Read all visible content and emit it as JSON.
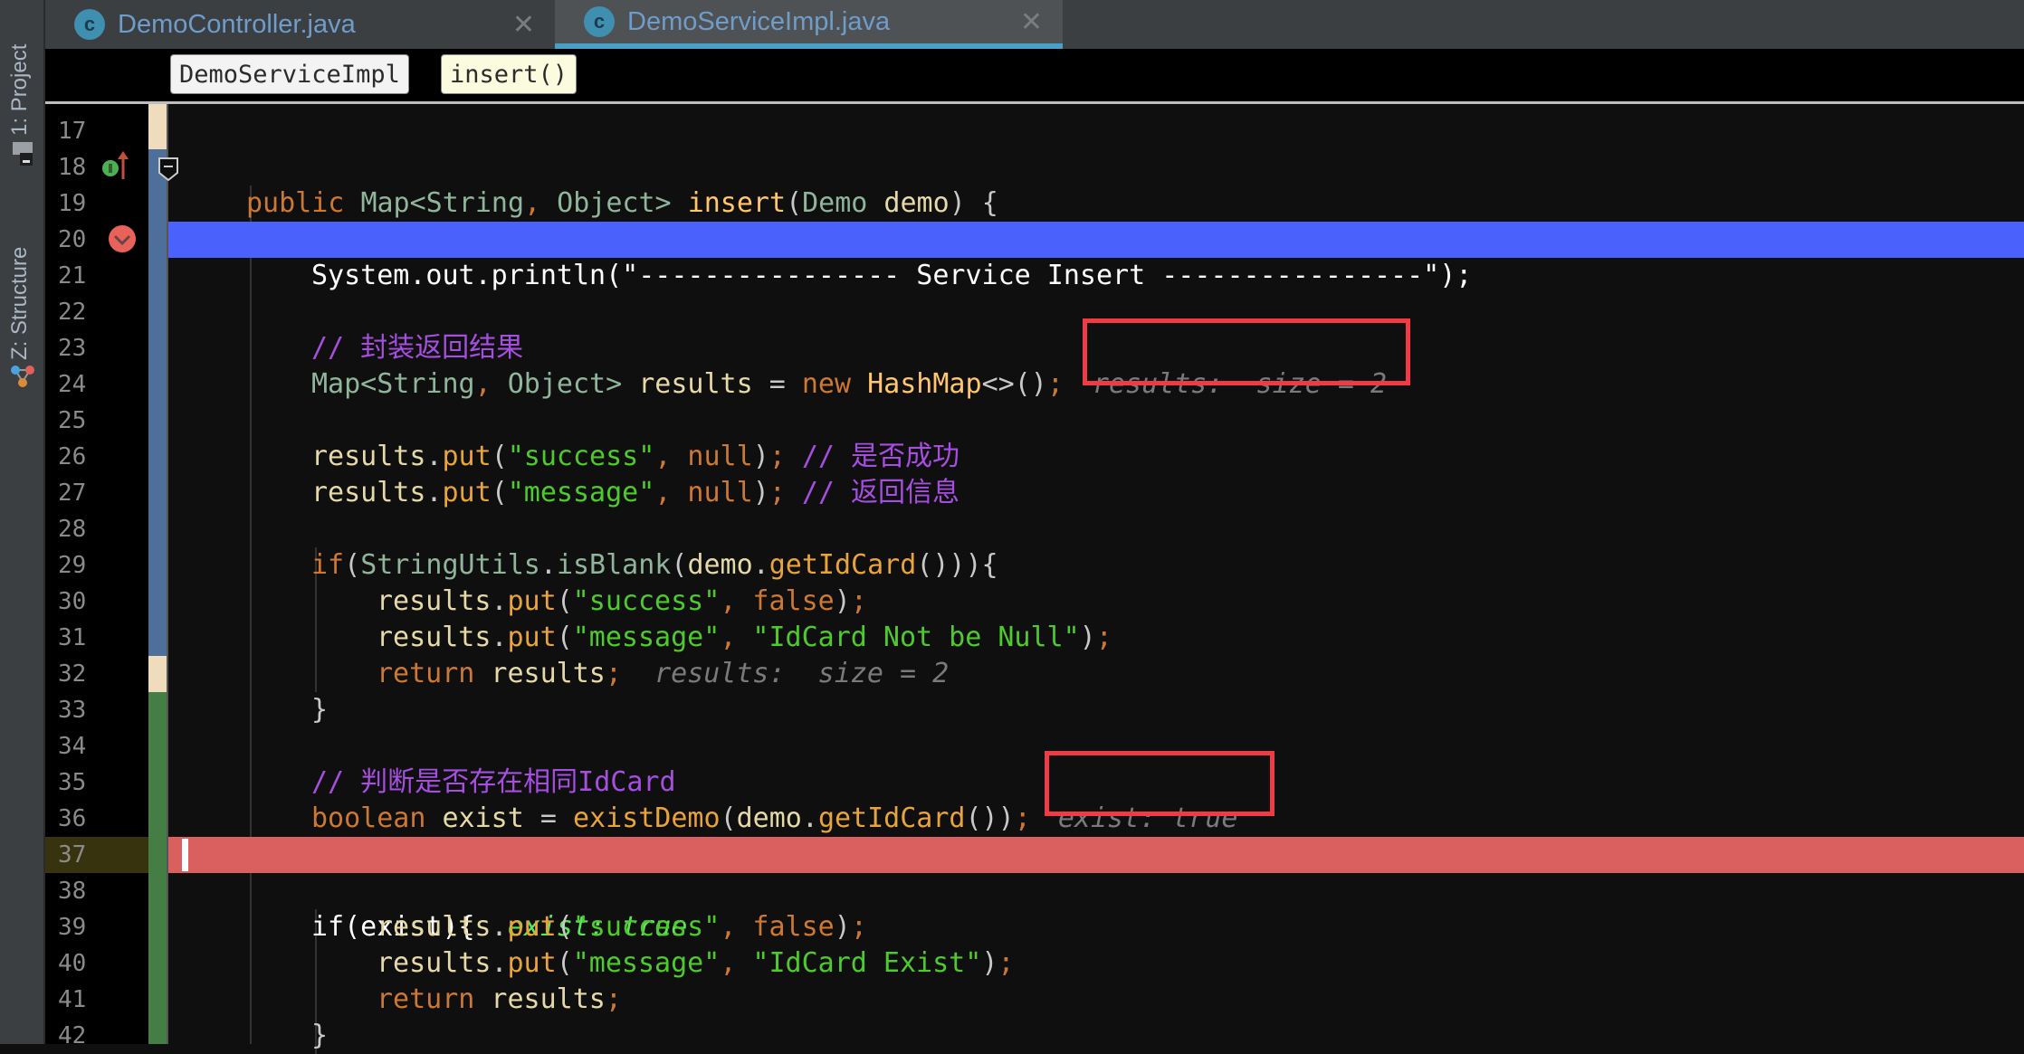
{
  "toolwindows": {
    "project": "1: Project",
    "structure": "Z: Structure"
  },
  "tabs": [
    {
      "label": "DemoController.java",
      "icon": "class-icon",
      "icon_glyph": "c",
      "active": false
    },
    {
      "label": "DemoServiceImpl.java",
      "icon": "class-icon",
      "icon_glyph": "c",
      "active": true
    }
  ],
  "close_glyph": "✕",
  "breadcrumbs": [
    "DemoServiceImpl",
    "insert()"
  ],
  "colors": {
    "execution_line": "#4a62fb",
    "breakpoint_line": "#d9605f",
    "tab_underline": "#4a9fc4",
    "annotation_box": "#f13b44"
  },
  "editor": {
    "lines": [
      {
        "n": "17"
      },
      {
        "n": "18",
        "gutter_icons": [
          "implements-icon",
          "overrides-arrow-icon"
        ]
      },
      {
        "n": "19"
      },
      {
        "n": "20",
        "gutter_icons": [
          "breakpoint-verified-icon"
        ],
        "highlight": "execution"
      },
      {
        "n": "21"
      },
      {
        "n": "22"
      },
      {
        "n": "23"
      },
      {
        "n": "24"
      },
      {
        "n": "25"
      },
      {
        "n": "26"
      },
      {
        "n": "27"
      },
      {
        "n": "28"
      },
      {
        "n": "29"
      },
      {
        "n": "30"
      },
      {
        "n": "31"
      },
      {
        "n": "32"
      },
      {
        "n": "33"
      },
      {
        "n": "34"
      },
      {
        "n": "35"
      },
      {
        "n": "36"
      },
      {
        "n": "37",
        "highlight": "breakpoint"
      },
      {
        "n": "38"
      },
      {
        "n": "39"
      },
      {
        "n": "40"
      },
      {
        "n": "41"
      },
      {
        "n": "42"
      }
    ],
    "code": {
      "l18": {
        "kw_public": "public",
        "ty_map": "Map<String",
        "comma": ",",
        "ty_obj": " Object>",
        "fn": "insert",
        "p1": "(",
        "ty_demo": "Demo",
        "var_demo": " demo",
        "p2": ") {"
      },
      "l20": {
        "text": "System.out.println(\"---------------- Service Insert ----------------\");"
      },
      "l22": {
        "comment": "// 封装返回结果"
      },
      "l23": {
        "ty_map": "Map<String",
        "comma": ",",
        "ty_obj": " Object>",
        "var": " results",
        "eq": " = ",
        "kw_new": "new",
        "ty_hash": " HashMap",
        "p": "<>()",
        "semi": ";",
        "hint": "results:  size = 2"
      },
      "l25": {
        "var": "results",
        "dot": ".",
        "mc": "put",
        "p1": "(",
        "str": "\"success\"",
        "comma": ",",
        "kw": " null",
        "p2": ")",
        "semi": ";",
        "comment": " // 是否成功"
      },
      "l26": {
        "var": "results",
        "dot": ".",
        "mc": "put",
        "p1": "(",
        "str": "\"message\"",
        "comma": ",",
        "kw": " null",
        "p2": ")",
        "semi": ";",
        "comment": " // 返回信息"
      },
      "l28": {
        "kw_if": "if",
        "p1": "(",
        "ty": "StringUtils",
        "dot": ".",
        "ty_m": "isBlank",
        "p2": "(",
        "var": "demo",
        "dot2": ".",
        "mc": "getIdCard",
        "p3": "())){"
      },
      "l29": {
        "var": "results",
        "dot": ".",
        "mc": "put",
        "p1": "(",
        "str": "\"success\"",
        "comma": ",",
        "kw": " false",
        "p2": ")",
        "semi": ";"
      },
      "l30": {
        "var": "results",
        "dot": ".",
        "mc": "put",
        "p1": "(",
        "str": "\"message\"",
        "comma": ",",
        "str2": " \"IdCard Not be Null\"",
        "p2": ")",
        "semi": ";"
      },
      "l31": {
        "kw": "return",
        "var": " results",
        "semi": ";",
        "hint": "results:  size = 2"
      },
      "l32": {
        "brace": "}"
      },
      "l34": {
        "comment": "// 判断是否存在相同IdCard"
      },
      "l35": {
        "kw": "boolean",
        "var": " exist",
        "eq": " = ",
        "mc": "existDemo",
        "p1": "(",
        "var2": "demo",
        "dot": ".",
        "mc2": "getIdCard",
        "p2": "())",
        "semi": ";",
        "hint": "exist: true"
      },
      "l37": {
        "text": "if(exist){",
        "hint": "exist: true"
      },
      "l38": {
        "var": "results",
        "dot": ".",
        "mc": "put",
        "p1": "(",
        "str": "\"success\"",
        "comma": ",",
        "kw": " false",
        "p2": ")",
        "semi": ";"
      },
      "l39": {
        "var": "results",
        "dot": ".",
        "mc": "put",
        "p1": "(",
        "str": "\"message\"",
        "comma": ",",
        "str2": " \"IdCard Exist\"",
        "p2": ")",
        "semi": ";"
      },
      "l40": {
        "kw": "return",
        "var": " results",
        "semi": ";"
      },
      "l41": {
        "brace": "}"
      }
    }
  }
}
